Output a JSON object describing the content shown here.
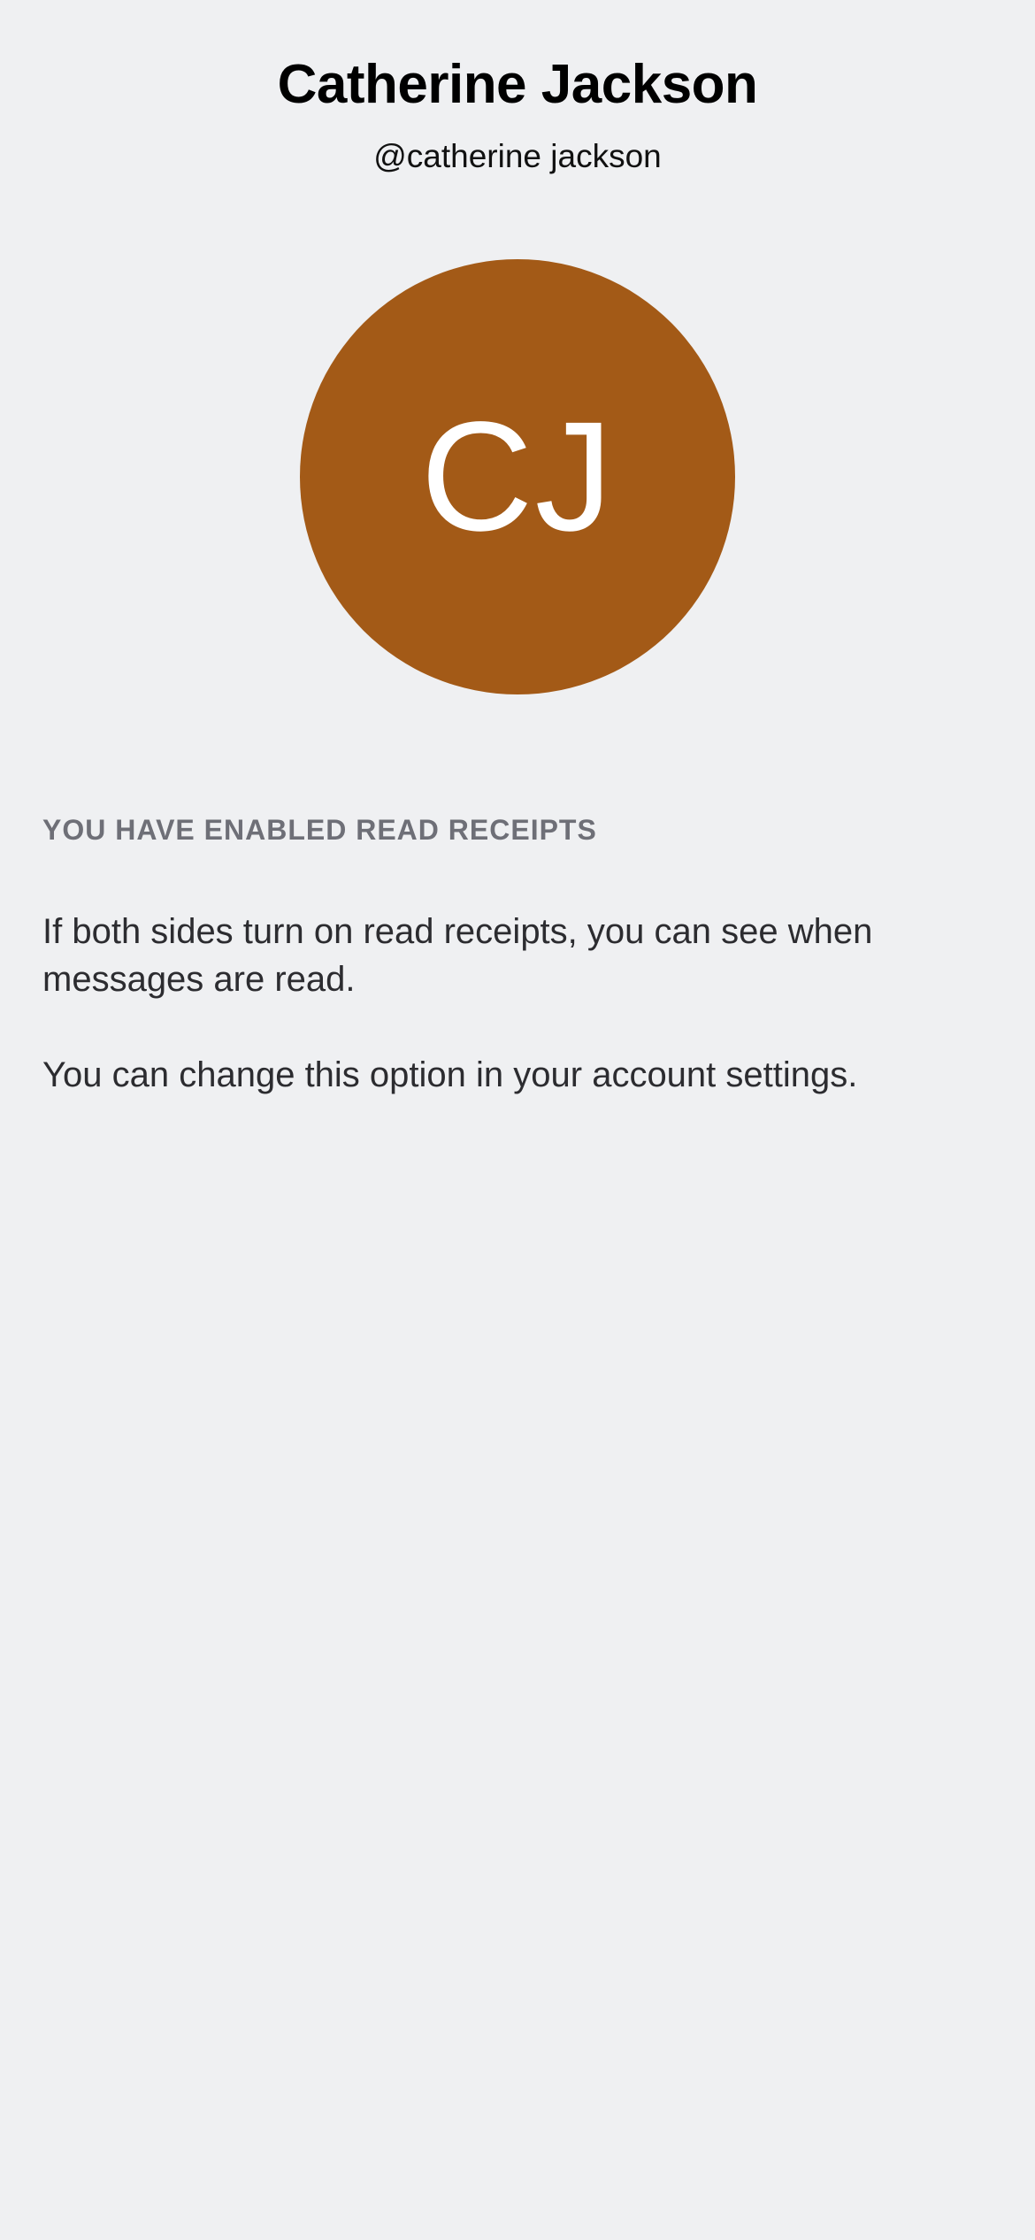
{
  "profile": {
    "display_name": "Catherine Jackson",
    "username": "@catherine jackson",
    "avatar": {
      "initials": "CJ",
      "background_color": "#a35a17",
      "text_color": "#ffffff"
    }
  },
  "read_receipts": {
    "heading": "YOU HAVE ENABLED READ RECEIPTS",
    "description": "If both sides turn on read receipts, you can see when messages are read.",
    "settings_hint": "You can change this option in your account settings."
  },
  "colors": {
    "background": "#eff0f2",
    "heading_text": "#6e6f77",
    "body_text": "#2c2c30"
  }
}
